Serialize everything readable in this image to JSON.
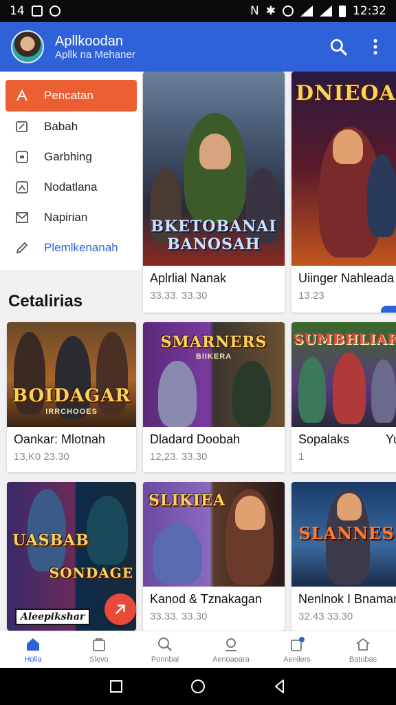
{
  "status_bar": {
    "left_text": "14",
    "time": "12:32"
  },
  "app_bar": {
    "title": "Apllkoodan",
    "subtitle": "Apllk na Mehaner"
  },
  "drawer": {
    "items": [
      {
        "label": "Pencatan",
        "icon": "pen-icon",
        "active": true
      },
      {
        "label": "Babah",
        "icon": "edit-icon"
      },
      {
        "label": "Garbhing",
        "icon": "square-icon"
      },
      {
        "label": "Nodatlana",
        "icon": "image-icon"
      },
      {
        "label": "Napirian",
        "icon": "mail-icon"
      },
      {
        "label": "Plemlkenanah",
        "icon": "pencil-icon",
        "link": true
      }
    ]
  },
  "section": {
    "title": "Cetalirias"
  },
  "featured": [
    {
      "name": "Aplrlial Nanak",
      "meta": "33.33. 33.30",
      "art_title": "BKETOBANAI BANOSAH"
    },
    {
      "name": "Uiinger Nahleada",
      "meta": "13.23",
      "art_title": "DNIEOAH"
    }
  ],
  "games": [
    {
      "name": "Oankar: Mlotnah",
      "meta": "13,K0 23.30",
      "art_title": "BOIDAGAR",
      "art_sub": "IRRCHOOES"
    },
    {
      "name": "Dladard Doobah",
      "meta": "12,23. 33.30",
      "art_title": "SMARNERS",
      "art_sub": "BIIKERA"
    },
    {
      "name": "Sopalaks",
      "meta": "1",
      "art_title": "SUMBHLIAK",
      "art_sub": "",
      "extra": "Yu"
    },
    {
      "name": "",
      "meta": "",
      "art_title": "UASBAB",
      "art_sub": "SONDAGE",
      "banner": "Aleepikshar"
    },
    {
      "name": "Kanod & Tznakagan",
      "meta": "33.33. 33.30",
      "art_title": "SLIKIEA",
      "art_sub": ""
    },
    {
      "name": "Nenlnok I Bnamar",
      "meta": "32.43 33.30",
      "art_title": "SLANNES",
      "art_sub": ""
    }
  ],
  "bottom_nav": [
    {
      "label": "Holia",
      "active": true
    },
    {
      "label": "Slevo"
    },
    {
      "label": "Ponnbai"
    },
    {
      "label": "Aenoaoara"
    },
    {
      "label": "Aenilers"
    },
    {
      "label": "Batubas"
    }
  ],
  "colors": {
    "primary": "#2f62d8",
    "accent": "#ec5f33",
    "fab": "#e84a3a"
  }
}
